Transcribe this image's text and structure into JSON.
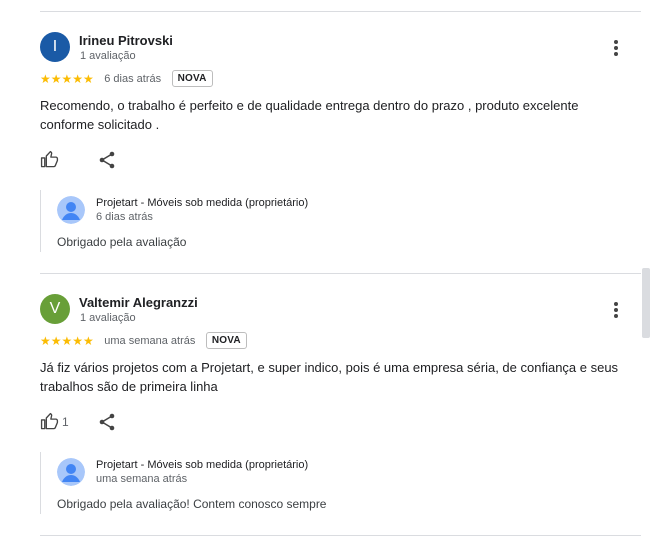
{
  "reviews": [
    {
      "initial": "I",
      "avatar_color": "#1a5aa6",
      "name": "Irineu Pitrovski",
      "count": "1 avaliação",
      "stars": "★★★★★",
      "when": "6 dias atrás",
      "badge": "NOVA",
      "text": "Recomendo, o trabalho é perfeito e de qualidade entrega dentro do prazo , produto excelente conforme solicitado .",
      "likes": "",
      "reply": {
        "owner": "Projetart - Móveis sob medida (proprietário)",
        "when": "6 dias atrás",
        "text": "Obrigado pela avaliação"
      }
    },
    {
      "initial": "V",
      "avatar_color": "#689f38",
      "name": "Valtemir Alegranzzi",
      "count": "1 avaliação",
      "stars": "★★★★★",
      "when": "uma semana atrás",
      "badge": "NOVA",
      "text": "Já fiz vários projetos com a Projetart, e super indico, pois é uma empresa séria, de confiança e seus trabalhos são de primeira linha",
      "likes": "1",
      "reply": {
        "owner": "Projetart - Móveis sob medida (proprietário)",
        "when": "uma semana atrás",
        "text": "Obrigado pela avaliação! Contem conosco sempre"
      }
    }
  ],
  "icons": {
    "like": "thumb-up-icon",
    "share": "share-icon",
    "menu": "more-vert-icon",
    "owner_avatar": "person-icon"
  },
  "colors": {
    "star": "#fbbc04",
    "owner_avatar_bg": "#a8c7fa",
    "owner_avatar_fg": "#4285f4"
  }
}
